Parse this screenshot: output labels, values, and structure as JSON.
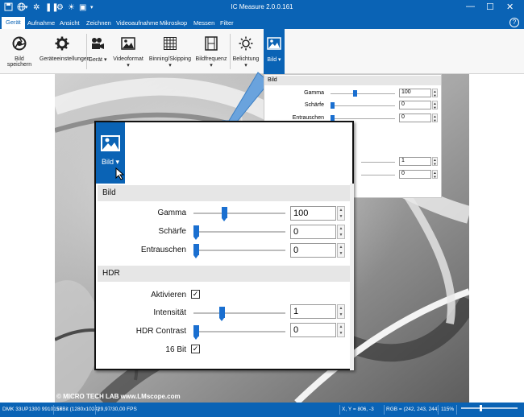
{
  "window": {
    "title": "IC Measure 2.0.0.161"
  },
  "menu": [
    "Gerät",
    "Aufnahme",
    "Ansicht",
    "Zeichnen",
    "Videoaufnahme",
    "Mikroskop",
    "Messen",
    "Filter"
  ],
  "ribbon": {
    "bild_speichern": "Bild speichern",
    "geraeteeinstellungen": "Geräteeinstellungen",
    "geraet": "Gerät",
    "videoformat": "Videoformat",
    "binning": "Binning/Skipping",
    "bildfrequenz": "Bildfrequenz",
    "belichtung": "Belichtung",
    "bild": "Bild"
  },
  "panel": {
    "bild_header": "Bild",
    "gamma_label": "Gamma",
    "gamma_value": "100",
    "gamma_level": 0.33,
    "schaerfe_label": "Schärfe",
    "schaerfe_value": "0",
    "schaerfe_level": 0.0,
    "entrauschen_label": "Entrauschen",
    "entrauschen_value": "0",
    "entrauschen_level": 0.0,
    "hdr_header": "HDR",
    "aktivieren_label": "Aktivieren",
    "aktivieren_checked": true,
    "intensitaet_label": "Intensität",
    "intensitaet_value": "1",
    "intensitaet_level": 0.3,
    "hdr_contrast_label": "HDR Contrast",
    "hdr_contrast_value": "0",
    "hdr_contrast_level": 0.0,
    "bit16_label": "16 Bit",
    "bit16_checked": true
  },
  "small_panel": {
    "bild_header": "Bild",
    "gamma_label": "Gamma",
    "gamma_value": "100",
    "schaerfe_label": "Schärfe",
    "schaerfe_value": "0",
    "entrauschen_label": "Entrauschen",
    "entrauschen_value": "0",
    "hdr_value_1": "1",
    "hdr_value_2": "0"
  },
  "status": {
    "device": "DMK 33UP1300 9910157",
    "format": "16Bit (1280x1024)",
    "fps": "29,97/30,00 FPS",
    "coords": "X, Y = 806, -3",
    "rgb": "RGB = (242, 243, 244)",
    "zoom": "115%"
  },
  "copyright": "©  MICRO TECH LAB   www.LMscope.com",
  "colors": {
    "accent": "#0a63b5",
    "slider": "#1a6fd0"
  }
}
